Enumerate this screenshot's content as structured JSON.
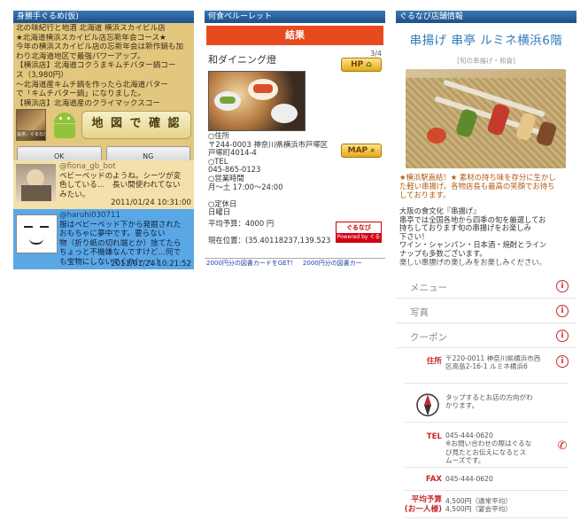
{
  "panel1": {
    "header": "身勝手ぐるめ(仮)",
    "lines": [
      "北の味紀行と地酒 北海道 横浜スカイビル店",
      "★北海道横浜スカイビル店忘新年会コース★",
      "今年の横浜スカイビル店の忘新年会は新作鍋も加",
      "わり北海道地区で最強パワーアップ。",
      "【横浜店】北海道コクうまキムチバター鍋コー",
      "ス（3,980円）",
      "～北海道産キムチ鍋を作ったら北海道バター",
      "で「キムチバター鍋」になりました。",
      "【横浜店】北海道産のクライマックスコー"
    ],
    "thumb_caption": "提供：ぐるなび",
    "map_button": "地 図 で 確 認",
    "ok_button": "OK",
    "ng_button": "NG",
    "tweets": [
      {
        "user": "@fiona_gb_bot",
        "text": [
          "ベビーベッドのようね。シーツが変",
          "色している…　長い間使われてない",
          "みたい。"
        ],
        "time": "2011/01/24 10:31:00"
      },
      {
        "user": "@haruhi030711",
        "text": [
          "服はベビーベッド下から発掘された",
          "おもちゃに夢中です。要らない",
          "物（折り紙の切れ端とか）捨てたら",
          "ちょっと不機嫌なんですけど…何で",
          "も宝物にしないでくれ(・・;)"
        ],
        "time": "2011/01/24 10:21:52"
      }
    ]
  },
  "panel2": {
    "header": "何食べルーレット",
    "result_banner": "結果",
    "restaurant": "和ダイニング燈",
    "pager": "3/4",
    "hp_button": "HP",
    "map_button": "MAP",
    "info_lines": [
      "○住所",
      "〒244-0003 神奈川県横浜市戸塚区",
      "戸塚町4014-4",
      "○TEL",
      "045-865-0123",
      "○営業時間",
      "月～土 17:00～24:00",
      "",
      "○定休日",
      "日曜日",
      "平均予算：4000 円",
      "",
      "現在位置：(35.40118237,139.523"
    ],
    "gnavi_top": "ぐるなび",
    "gnavi_bottom": "Powered by ぐるなび",
    "ad_text": "2000円分の図書カードをGET！　2000円分の図書カー"
  },
  "panel3": {
    "header": "ぐるなび店舗情報",
    "title": "串揚げ 串亭 ルミネ横浜6階",
    "subtitle": "[旬の串揚げ・和食]",
    "promo": [
      "★横浜駅直結！★ 素材の持ち味を存分に生かし",
      "た軽い串揚げ。各物店長も最高の笑顔でお待ち",
      "しております。"
    ],
    "desc": [
      "大阪の食文化『串揚げ』",
      "串亭では全国各地から四季の旬を厳選してお",
      "持ちしております旬の串揚げをお楽しみ",
      "下さい！",
      "ワイン・シャンパン・日本酒・焼酎とライン",
      "ナップも多数ございます。",
      "楽しい串揚げの楽しみをお楽しみください。"
    ],
    "menu": [
      "メニュー",
      "写真",
      "クーポン"
    ],
    "address_label": "住所",
    "address": [
      "〒220-0011 神奈川県横浜市西",
      "区高島2-16-1 ルミネ横浜6"
    ],
    "map_hint": [
      "タップするとお店の方向がわ",
      "かります。"
    ],
    "tel_label": "TEL",
    "tel": [
      "045-444-0620",
      "※お問い合わせの際はぐるな",
      "び見たとお伝えになるとス",
      "ムーズです。"
    ],
    "fax_label": "FAX",
    "fax": "045-444-0620",
    "budget_label": [
      "平均予算",
      "(お一人様)"
    ],
    "budget": [
      "4,500円（通常平均）",
      "4,500円（宴会平均）"
    ]
  }
}
